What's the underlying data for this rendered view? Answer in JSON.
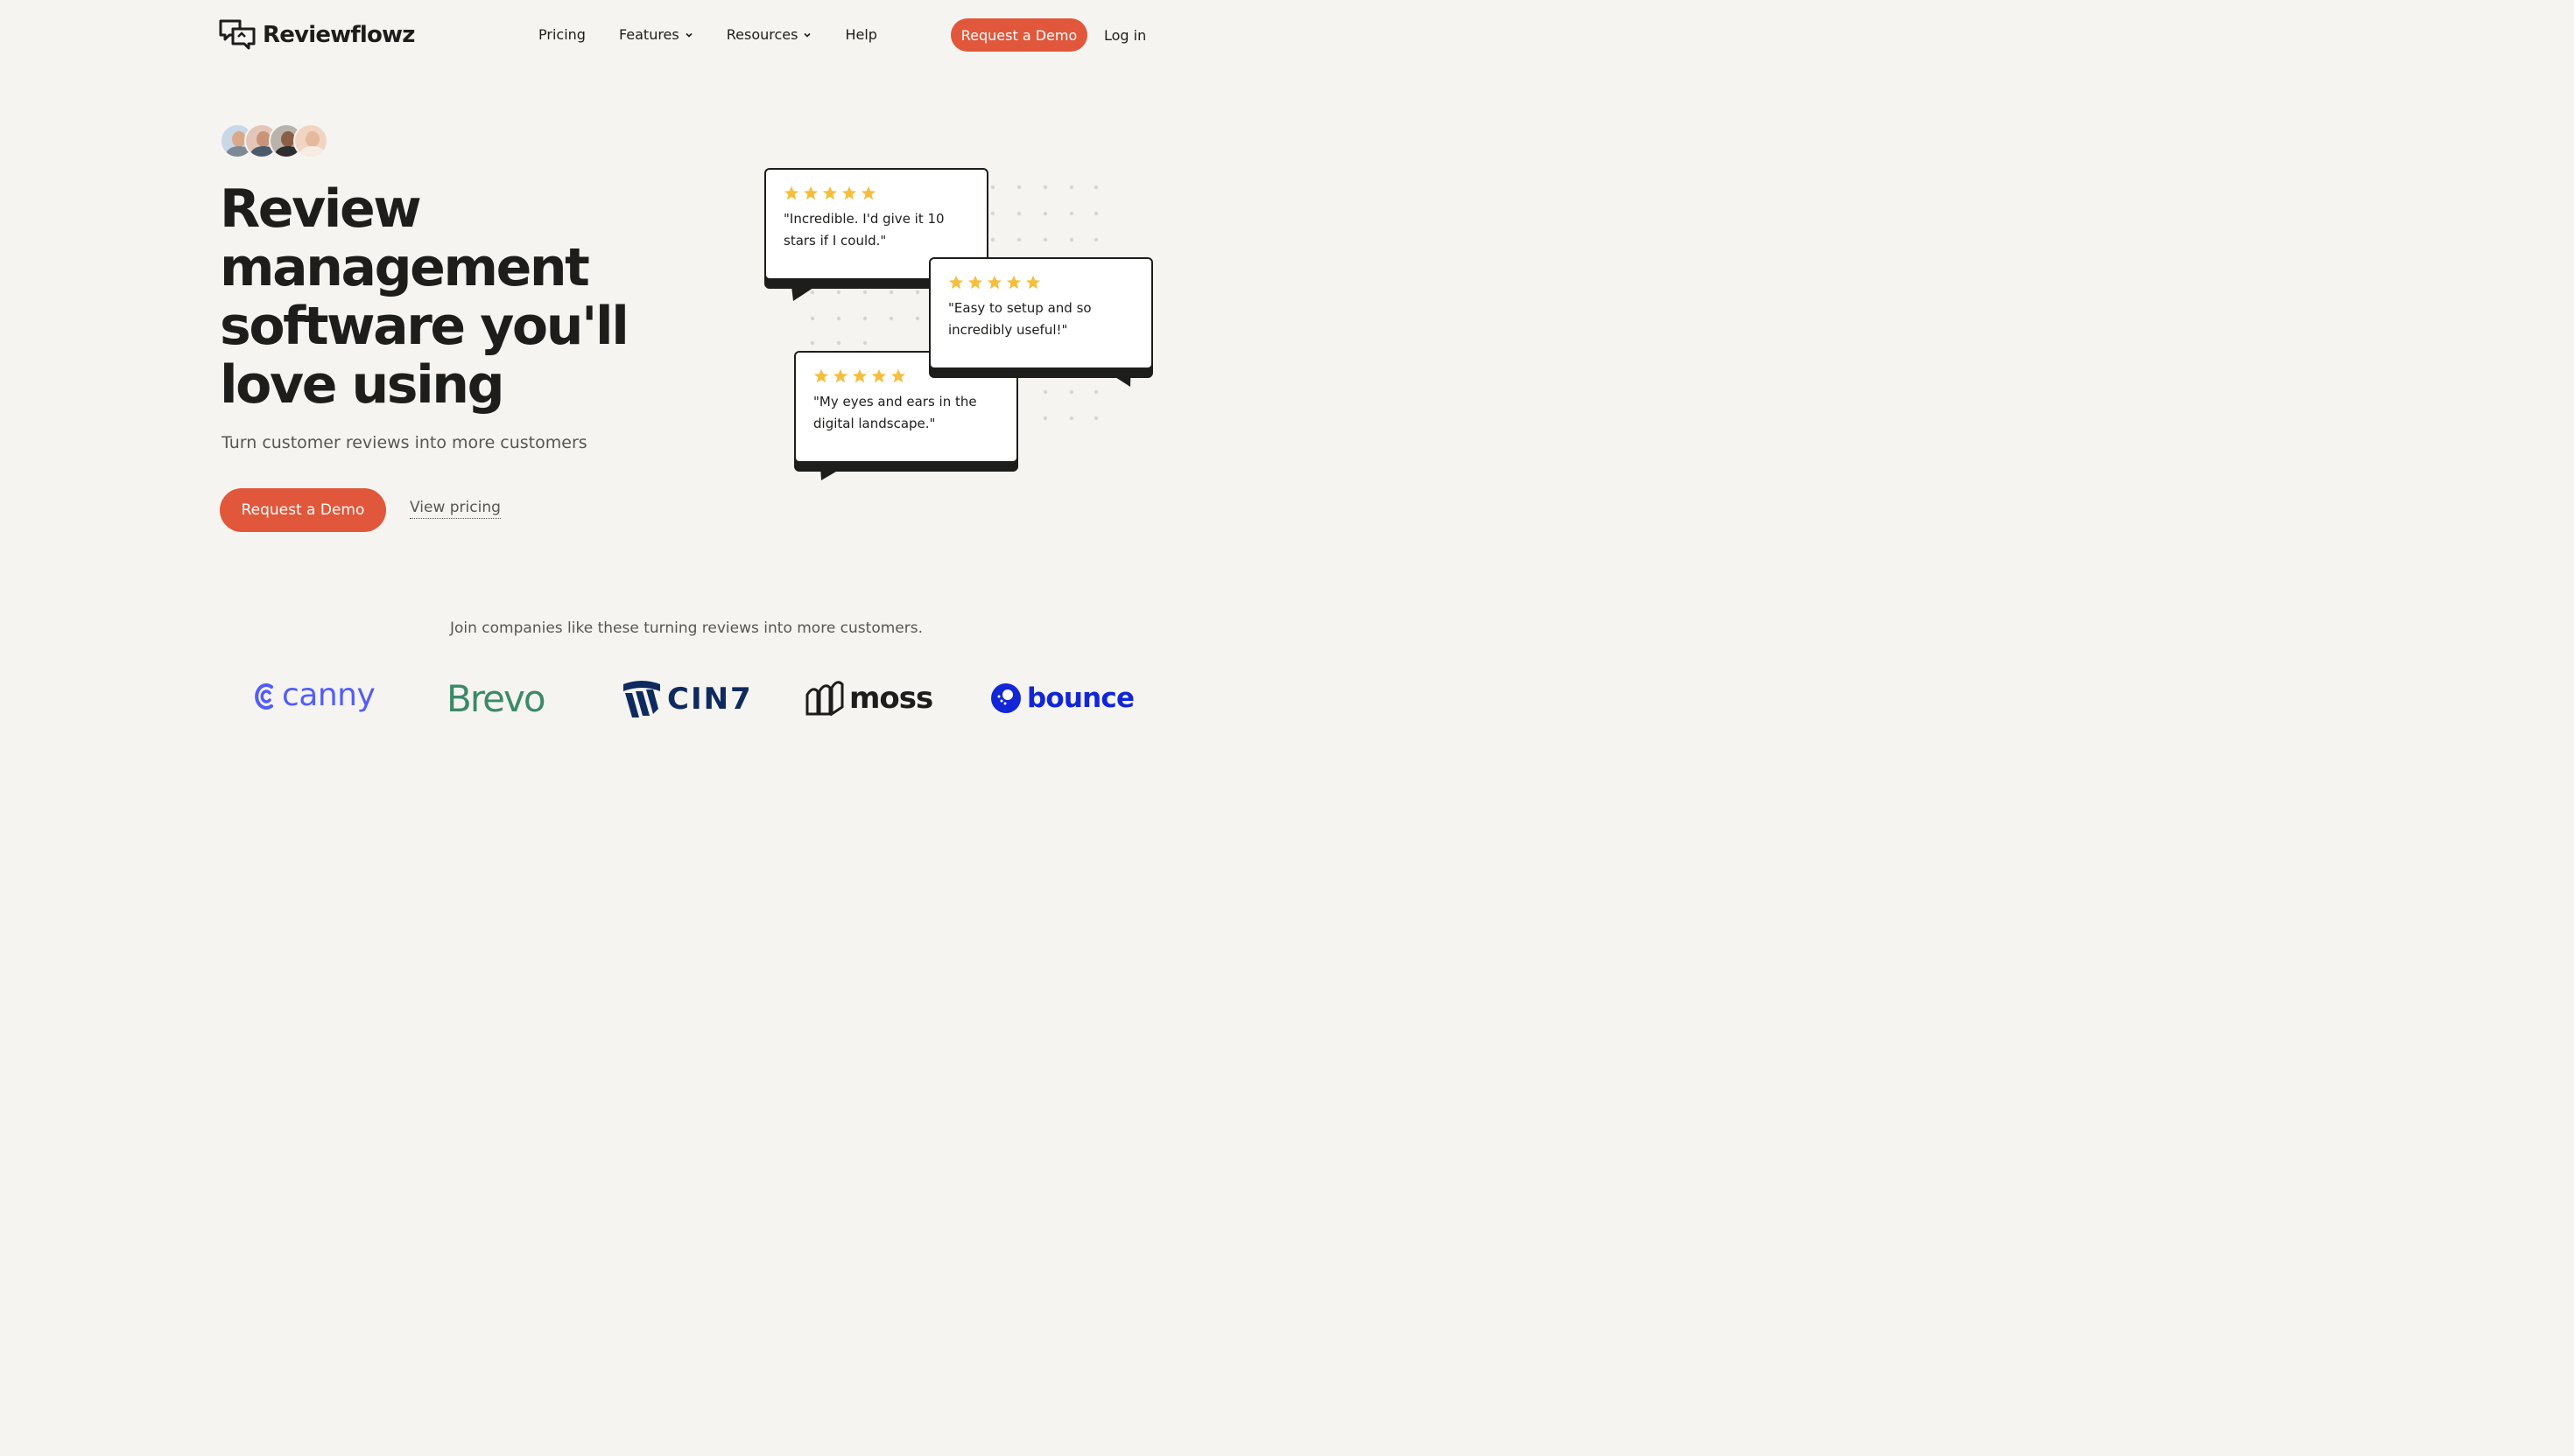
{
  "header": {
    "brand_name": "Reviewflowz",
    "nav": [
      {
        "label": "Pricing",
        "dropdown": false
      },
      {
        "label": "Features",
        "dropdown": true
      },
      {
        "label": "Resources",
        "dropdown": true
      },
      {
        "label": "Help",
        "dropdown": false
      }
    ],
    "cta_label": "Request a Demo",
    "login_label": "Log in"
  },
  "hero": {
    "headline_lines": [
      "Review",
      "management",
      "software you'll",
      "love using"
    ],
    "subheadline": "Turn customer reviews into more customers",
    "primary_cta": "Request a Demo",
    "secondary_cta": "View pricing"
  },
  "reviews": [
    {
      "rating": 5,
      "quote": "\"Incredible. I'd give it 10 stars if I could.\""
    },
    {
      "rating": 5,
      "quote": "\"Easy to setup and so incredibly useful!\""
    },
    {
      "rating": 5,
      "quote": "\"My eyes and ears in the digital landscape.\""
    }
  ],
  "customers": {
    "intro": "Join companies like these turning reviews into more customers.",
    "logos": [
      {
        "name": "canny",
        "color": "#525df9"
      },
      {
        "name": "Brevo",
        "color": "#3b8a66"
      },
      {
        "name": "CIN7",
        "color": "#0f2a5e"
      },
      {
        "name": "moss",
        "color": "#1d1d1b"
      },
      {
        "name": "bounce",
        "color": "#1226d6"
      }
    ]
  },
  "colors": {
    "accent": "#e0573b",
    "background": "#f6f4f1",
    "star": "#f5be3c",
    "ink": "#1d1d1b"
  }
}
